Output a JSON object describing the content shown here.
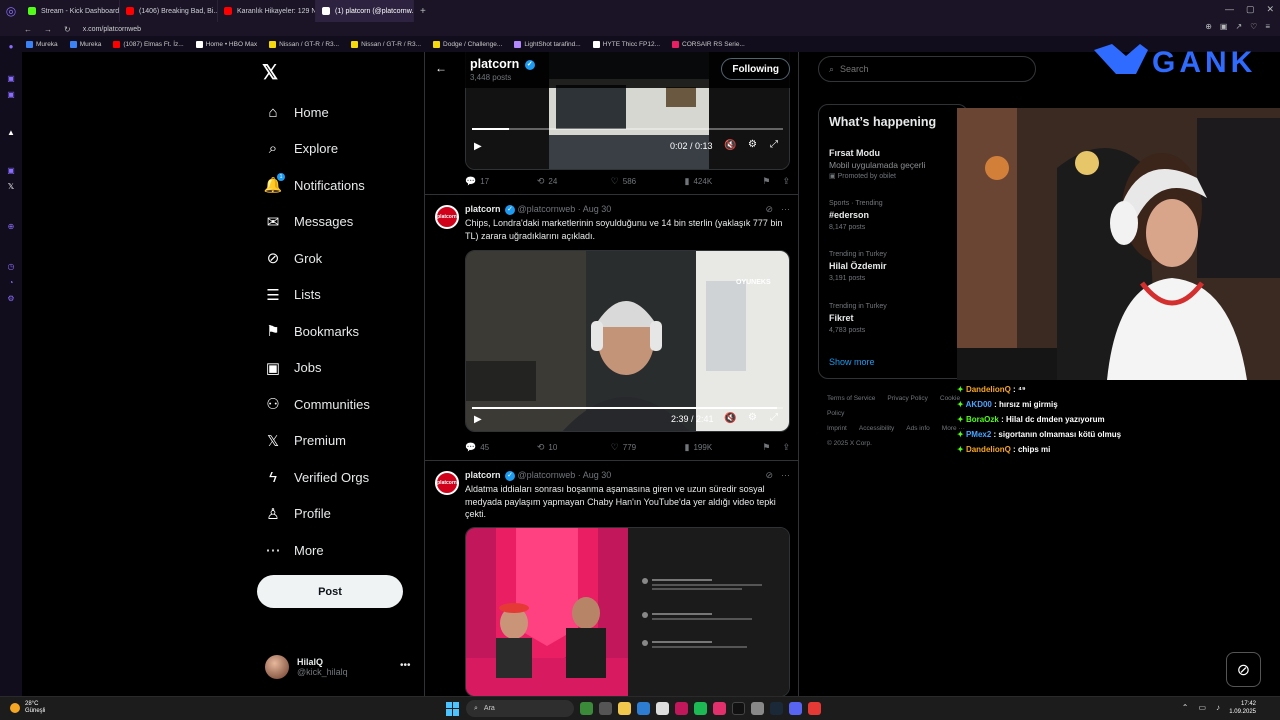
{
  "browser": {
    "tabs": [
      {
        "title": "Stream - Kick Dashboard",
        "color": "#53fc18",
        "active": false
      },
      {
        "title": "(1406) Breaking Bad, Bi...",
        "color": "#ff0000",
        "active": false
      },
      {
        "title": "Karanlık Hikayeler: 129 N...",
        "color": "#ff0000",
        "active": false
      },
      {
        "title": "(1) platcorn (@platcornw...",
        "color": "#ffffff",
        "active": true
      }
    ],
    "url": "x.com/platcornweb",
    "bookmarks": [
      {
        "label": "Mureka",
        "color": "#3b82f6"
      },
      {
        "label": "Mureka",
        "color": "#3b82f6"
      },
      {
        "label": "(1087) Elmas Ft. İz...",
        "color": "#ff0000"
      },
      {
        "label": "Home • HBO Max",
        "color": "#ffffff"
      },
      {
        "label": "Nissan / GT-R / R3...",
        "color": "#f5d90a"
      },
      {
        "label": "Nissan / GT-R / R3...",
        "color": "#f5d90a"
      },
      {
        "label": "Dodge / Challenge...",
        "color": "#f5d90a"
      },
      {
        "label": "LightShot tarafind...",
        "color": "#b388ff"
      },
      {
        "label": "HYTE Thicc FP12...",
        "color": "#ffffff"
      },
      {
        "label": "CORSAIR RS Serie...",
        "color": "#e91e63"
      }
    ]
  },
  "nav": {
    "items": [
      {
        "label": "Home",
        "icon": "home-icon",
        "glyph": "⌂"
      },
      {
        "label": "Explore",
        "icon": "search-icon",
        "glyph": "⌕"
      },
      {
        "label": "Notifications",
        "icon": "bell-icon",
        "glyph": "🔔"
      },
      {
        "label": "Messages",
        "icon": "envelope-icon",
        "glyph": "✉"
      },
      {
        "label": "Grok",
        "icon": "grok-icon",
        "glyph": "⊘"
      },
      {
        "label": "Lists",
        "icon": "list-icon",
        "glyph": "☰"
      },
      {
        "label": "Bookmarks",
        "icon": "bookmark-icon",
        "glyph": "⚑"
      },
      {
        "label": "Jobs",
        "icon": "briefcase-icon",
        "glyph": "▣"
      },
      {
        "label": "Communities",
        "icon": "people-icon",
        "glyph": "⚇"
      },
      {
        "label": "Premium",
        "icon": "x-logo-icon",
        "glyph": "𝕏"
      },
      {
        "label": "Verified Orgs",
        "icon": "lightning-icon",
        "glyph": "ϟ"
      },
      {
        "label": "Profile",
        "icon": "person-icon",
        "glyph": "♙"
      },
      {
        "label": "More",
        "icon": "more-circle-icon",
        "glyph": "⋯"
      }
    ],
    "notifications_count": "1",
    "post_label": "Post"
  },
  "account": {
    "name": "HilalQ",
    "handle": "@kick_hilalq"
  },
  "header": {
    "name": "platcorn",
    "posts": "3,448 posts",
    "follow_label": "Following"
  },
  "top_video": {
    "time": "0:02 / 0:13",
    "progress": 0.12
  },
  "top_actions": {
    "replies": "17",
    "reposts": "24",
    "likes": "586",
    "views": "424K"
  },
  "tweets": [
    {
      "name": "platcorn",
      "handle": "@platcornweb",
      "date": "Aug 30",
      "avatar_text": "platcorn",
      "text": "Chips, Londra'daki marketlerinin soyulduğunu ve 14 bin sterlin (yaklaşık 777 bin TL) zarara uğradıklarını açıkladı.",
      "video_time": "2:39 / 2:41",
      "progress": 0.98,
      "watermark": "OYUNEKS",
      "replies": "45",
      "reposts": "10",
      "likes": "779",
      "views": "199K"
    },
    {
      "name": "platcorn",
      "handle": "@platcornweb",
      "date": "Aug 30",
      "avatar_text": "platcorn",
      "text": "Aldatma iddiaları sonrası boşanma aşamasına giren ve uzun süredir sosyal medyada paylaşım yapmayan Chaby Han'ın YouTube'da yer aldığı video tepki çekti."
    }
  ],
  "search": {
    "placeholder": "Search"
  },
  "trends": {
    "title": "What’s happening",
    "items": [
      {
        "context": "",
        "title": "Fırsat Modu",
        "count": "Mobil uygulamada geçerli"
      },
      {
        "context": "Sports · Trending",
        "title": "#ederson",
        "count": "8,147 posts"
      },
      {
        "context": "Trending in Turkey",
        "title": "Hilal Özdemir",
        "count": "3,191 posts"
      },
      {
        "context": "Trending in Turkey",
        "title": "Fikret",
        "count": "4,783 posts"
      }
    ],
    "promoted": "Promoted by obilet",
    "show_more": "Show more"
  },
  "footer": {
    "links": [
      "Terms of Service",
      "Privacy Policy",
      "Cookie Policy",
      "Imprint",
      "Accessibility",
      "Ads info",
      "More ···",
      "© 2025 X Corp."
    ]
  },
  "stream": {
    "logo_text": "GANK",
    "logo_color": "#2f6bff"
  },
  "chat": [
    {
      "user": "DandelionQ",
      "color": "#f5a623",
      "message": "⁴⁹"
    },
    {
      "user": "AKD00",
      "color": "#4aa3ff",
      "message": "hırsız mi girmiş"
    },
    {
      "user": "BoraOzk",
      "color": "#53fc18",
      "message": "Hilal dc dmden yazıyorum"
    },
    {
      "user": "PMex2",
      "color": "#4aa3ff",
      "message": "sigortanın olmaması kötü olmuş"
    },
    {
      "user": "DandelionQ",
      "color": "#f5a623",
      "message": "chips mi"
    }
  ],
  "taskbar": {
    "weather_temp": "28°C",
    "weather_desc": "Güneşli",
    "search_label": "Ara",
    "time": "17:42",
    "date": "1.09.2025"
  },
  "colors": {
    "accent": "#1d9bf0",
    "kick_green": "#53fc18"
  }
}
